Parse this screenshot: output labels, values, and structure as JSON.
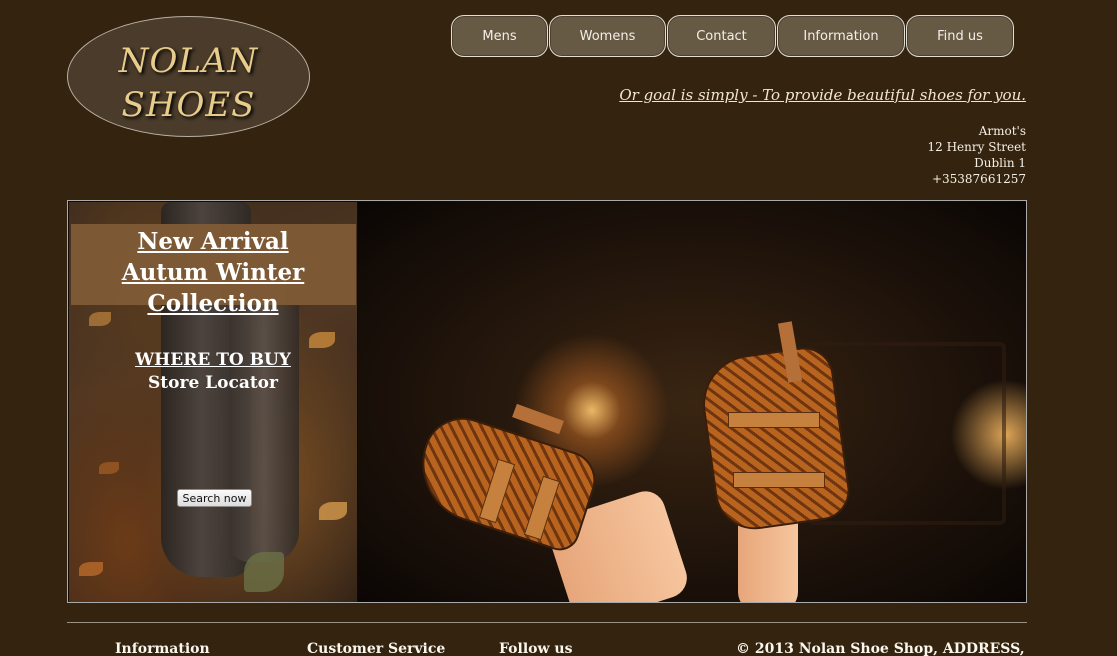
{
  "logo": {
    "line1": "NOLAN",
    "line2": "SHOES"
  },
  "nav": [
    {
      "label": "Mens"
    },
    {
      "label": "Womens"
    },
    {
      "label": "Contact"
    },
    {
      "label": "Information"
    },
    {
      "label": "Find us"
    }
  ],
  "tagline": "Or goal is simply - To provide beautiful shoes for you.",
  "address": {
    "name": "Armot's",
    "street": "12 Henry Street",
    "city": "Dublin 1",
    "phone": "+35387661257"
  },
  "banner": {
    "promo_line1": "New Arrival",
    "promo_line2": "Autum Winter",
    "promo_line3": "Collection",
    "where_to_buy": "WHERE TO BUY",
    "store_locator": "Store Locator",
    "search_button": "Search now"
  },
  "footer": {
    "information": "Information",
    "customer_service": "Customer Service",
    "follow_us": "Follow us",
    "copyright": "© 2013 Nolan Shoe Shop, ADDRESS,"
  }
}
